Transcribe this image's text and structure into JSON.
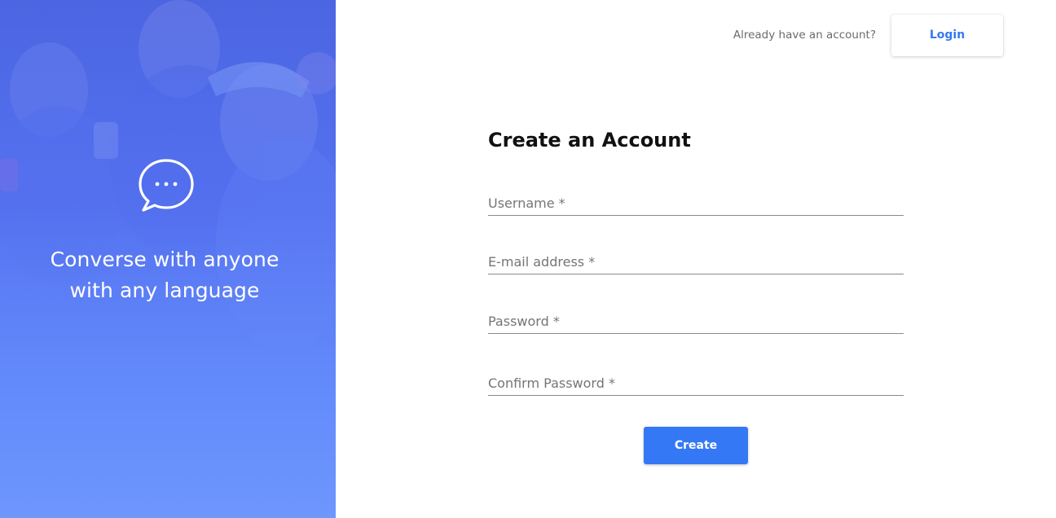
{
  "hero": {
    "tagline_line1": "Converse with anyone",
    "tagline_line2": "with any language",
    "icon": "chat-bubble-icon"
  },
  "header": {
    "prompt_text": "Already have an account?",
    "login_label": "Login"
  },
  "form": {
    "title": "Create an Account",
    "fields": [
      {
        "label": "Username",
        "required_mark": "*",
        "value": ""
      },
      {
        "label": "E-mail address",
        "required_mark": "*",
        "value": ""
      },
      {
        "label": "Password",
        "required_mark": "*",
        "value": ""
      },
      {
        "label": "Confirm Password",
        "required_mark": "*",
        "value": ""
      }
    ],
    "submit_label": "Create"
  },
  "colors": {
    "accent": "#3578f5",
    "login_text": "#3579ef",
    "hero_top": "#4f6cf2",
    "hero_bottom": "#6e93fc"
  }
}
